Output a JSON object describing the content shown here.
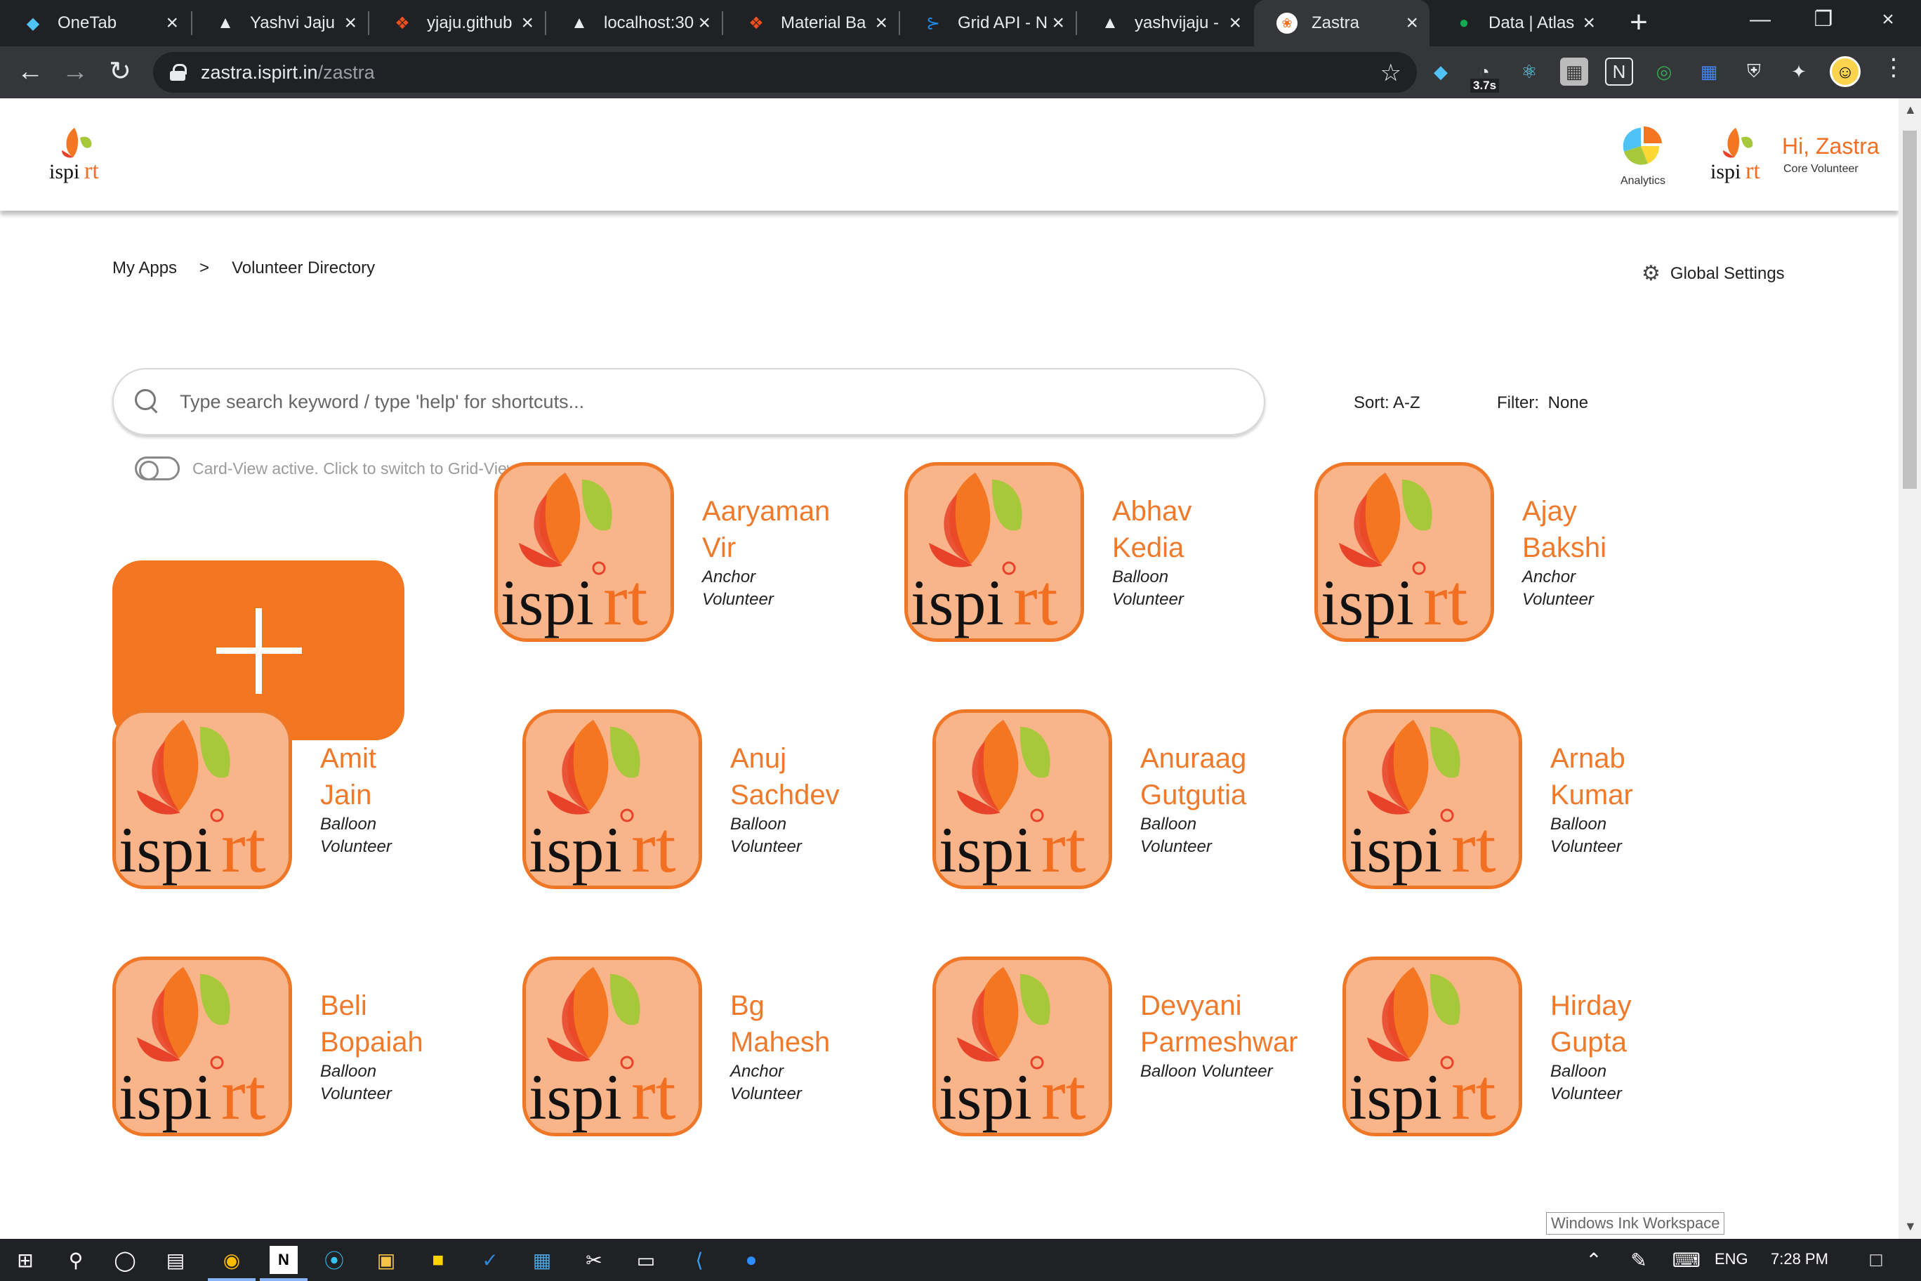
{
  "browser": {
    "tabs": [
      {
        "title": "OneTab",
        "icon": "onetab-icon"
      },
      {
        "title": "Yashvi Jaju",
        "icon": "vercel-icon"
      },
      {
        "title": "yjaju.github",
        "icon": "figma-icon"
      },
      {
        "title": "localhost:30",
        "icon": "vercel-icon"
      },
      {
        "title": "Material Ba",
        "icon": "figma-icon"
      },
      {
        "title": "Grid API - N",
        "icon": "mui-icon"
      },
      {
        "title": "yashvijaju -",
        "icon": "vercel-icon"
      },
      {
        "title": "Zastra",
        "icon": "ispirt-icon",
        "active": true
      },
      {
        "title": "Data | Atlas",
        "icon": "leaf-icon"
      }
    ],
    "url_host": "zastra.ispirt.in",
    "url_path": "/zastra",
    "ext_badge": "3.7s"
  },
  "header": {
    "analytics_label": "Analytics",
    "greeting": "Hi, Zastra",
    "role": "Core Volunteer",
    "brand_color": "#f26f21"
  },
  "breadcrumb": {
    "home": "My Apps",
    "separator": ">",
    "current": "Volunteer Directory"
  },
  "settings_label": "Global Settings",
  "search": {
    "placeholder": "Type search keyword / type 'help' for shortcuts..."
  },
  "sort": {
    "label": "Sort:",
    "value": "A-Z"
  },
  "filter": {
    "label": "Filter:",
    "value": "None"
  },
  "view_toggle_text": "Card-View active. Click to switch to Grid-View.",
  "volunteers": [
    {
      "name1": "Aaryaman",
      "name2": "Vir",
      "role1": "Anchor",
      "role2": "Volunteer"
    },
    {
      "name1": "Abhav",
      "name2": "Kedia",
      "role1": "Balloon",
      "role2": "Volunteer"
    },
    {
      "name1": "Ajay",
      "name2": "Bakshi",
      "role1": "Anchor",
      "role2": "Volunteer"
    },
    {
      "name1": "Amit",
      "name2": "Jain",
      "role1": "Balloon",
      "role2": "Volunteer"
    },
    {
      "name1": "Anuj",
      "name2": "Sachdev",
      "role1": "Balloon",
      "role2": "Volunteer"
    },
    {
      "name1": "Anuraag",
      "name2": "Gutgutia",
      "role1": "Balloon",
      "role2": "Volunteer"
    },
    {
      "name1": "Arnab",
      "name2": "Kumar",
      "role1": "Balloon",
      "role2": "Volunteer"
    },
    {
      "name1": "Beli",
      "name2": "Bopaiah",
      "role1": "Balloon",
      "role2": "Volunteer"
    },
    {
      "name1": "Bg",
      "name2": "Mahesh",
      "role1": "Anchor",
      "role2": "Volunteer"
    },
    {
      "name1": "Devyani",
      "name2": "Parmeshwar",
      "role1": "Balloon Volunteer",
      "role2": ""
    },
    {
      "name1": "Hirday",
      "name2": "Gupta",
      "role1": "Balloon",
      "role2": "Volunteer"
    }
  ],
  "taskbar": {
    "language": "ENG",
    "time": "7:28 PM",
    "ink_tooltip": "Windows Ink Workspace"
  }
}
